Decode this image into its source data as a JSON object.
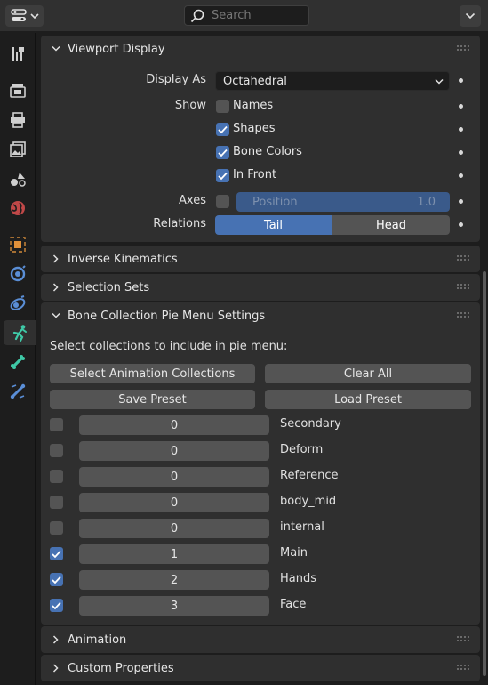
{
  "header": {
    "search_placeholder": "Search"
  },
  "sidebar": {
    "tabs": [
      {
        "name": "tool-icon"
      },
      {
        "name": "render-icon"
      },
      {
        "name": "output-icon"
      },
      {
        "name": "view-layer-icon"
      },
      {
        "name": "scene-icon"
      },
      {
        "name": "world-icon"
      },
      {
        "name": "object-icon"
      },
      {
        "name": "modifier-icon"
      },
      {
        "name": "physics-icon"
      },
      {
        "name": "armature-data-icon",
        "active": true
      },
      {
        "name": "bone-icon"
      },
      {
        "name": "bone-constraint-icon"
      }
    ]
  },
  "viewport_display": {
    "title": "Viewport Display",
    "display_as_label": "Display As",
    "display_as_value": "Octahedral",
    "show_label": "Show",
    "names_label": "Names",
    "names_checked": false,
    "shapes_label": "Shapes",
    "shapes_checked": true,
    "bone_colors_label": "Bone Colors",
    "bone_colors_checked": true,
    "in_front_label": "In Front",
    "in_front_checked": true,
    "axes_label": "Axes",
    "axes_checked": false,
    "position_label": "Position",
    "position_value": "1.0",
    "relations_label": "Relations",
    "relations_tail": "Tail",
    "relations_head": "Head",
    "relations_selected": "Tail"
  },
  "inverse_kinematics": {
    "title": "Inverse Kinematics"
  },
  "selection_sets": {
    "title": "Selection Sets"
  },
  "pie_menu": {
    "title": "Bone Collection Pie Menu Settings",
    "instruction": "Select collections to include in pie menu:",
    "select_anim_btn": "Select Animation Collections",
    "clear_all_btn": "Clear All",
    "save_preset_btn": "Save Preset",
    "load_preset_btn": "Load Preset",
    "collections": [
      {
        "checked": false,
        "value": "0",
        "name": "Secondary"
      },
      {
        "checked": false,
        "value": "0",
        "name": "Deform"
      },
      {
        "checked": false,
        "value": "0",
        "name": "Reference"
      },
      {
        "checked": false,
        "value": "0",
        "name": "body_mid"
      },
      {
        "checked": false,
        "value": "0",
        "name": "internal"
      },
      {
        "checked": true,
        "value": "1",
        "name": "Main"
      },
      {
        "checked": true,
        "value": "2",
        "name": "Hands"
      },
      {
        "checked": true,
        "value": "3",
        "name": "Face"
      }
    ]
  },
  "animation": {
    "title": "Animation"
  },
  "custom_properties": {
    "title": "Custom Properties"
  }
}
